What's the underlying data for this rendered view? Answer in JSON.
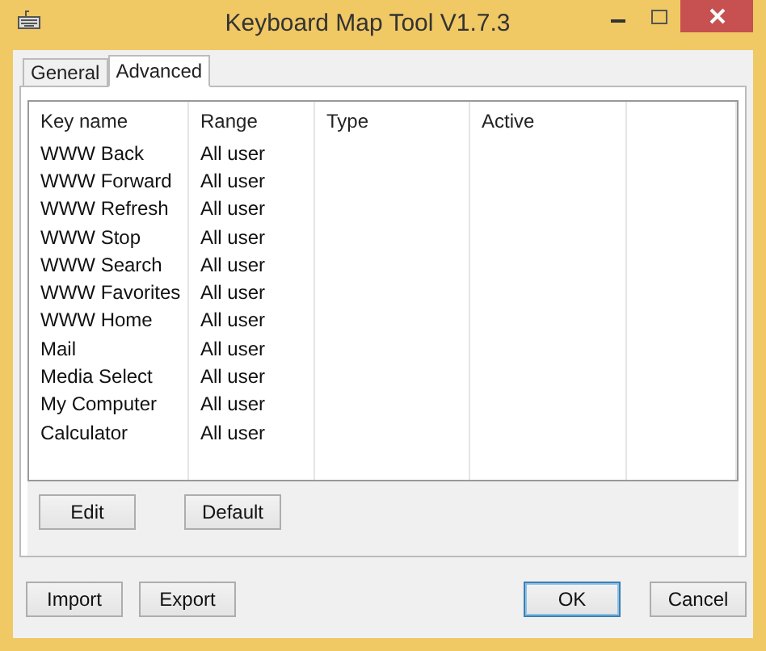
{
  "window": {
    "title": "Keyboard Map Tool V1.7.3"
  },
  "tabs": [
    {
      "label": "General",
      "selected": false
    },
    {
      "label": "Advanced",
      "selected": true
    }
  ],
  "table": {
    "columns": [
      "Key name",
      "Range",
      "Type",
      "Active"
    ],
    "rows": [
      {
        "key_name": "WWW Back",
        "range": "All user"
      },
      {
        "key_name": "WWW Forward",
        "range": "All user"
      },
      {
        "key_name": "WWW Refresh",
        "range": "All user"
      },
      {
        "key_name": "WWW Stop",
        "range": "All user"
      },
      {
        "key_name": "WWW Search",
        "range": "All user"
      },
      {
        "key_name": "WWW Favorites",
        "range": "All user"
      },
      {
        "key_name": "WWW Home",
        "range": "All user"
      },
      {
        "key_name": "Mail",
        "range": "All user"
      },
      {
        "key_name": "Media Select",
        "range": "All user"
      },
      {
        "key_name": "My Computer",
        "range": "All user"
      },
      {
        "key_name": "Calculator",
        "range": "All user"
      }
    ]
  },
  "panel_buttons": [
    {
      "label": "Edit",
      "default": false
    },
    {
      "label": "Default",
      "default": false
    }
  ],
  "dialog_buttons": [
    {
      "label": "Import",
      "default": false
    },
    {
      "label": "Export",
      "default": false
    },
    {
      "label": "OK",
      "default": true
    },
    {
      "label": "Cancel",
      "default": false
    }
  ]
}
